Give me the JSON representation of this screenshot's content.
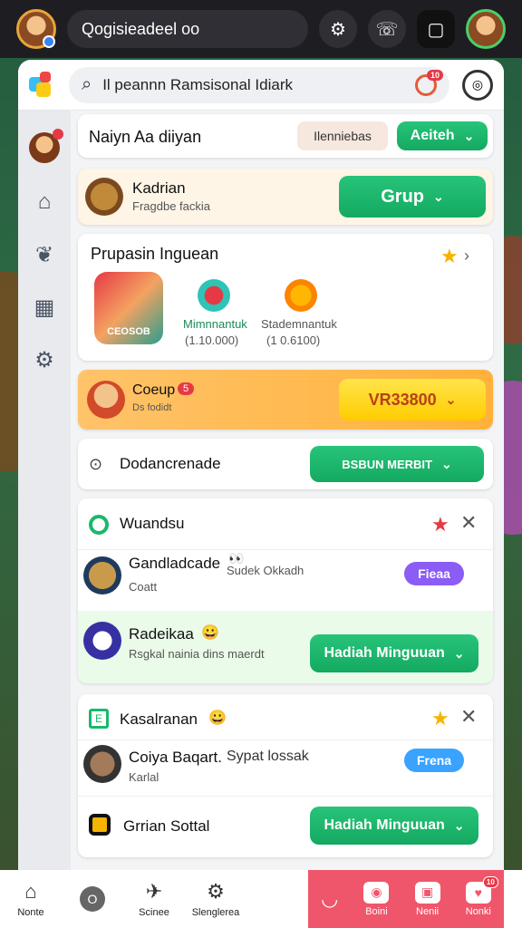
{
  "topbar": {
    "search_text": "Qogisieadeel oo"
  },
  "header": {
    "search_text": "Il peannn Ramsisonal Idiark",
    "notif_count": "10"
  },
  "cards": {
    "row1": {
      "title": "Naiyn Aa diiyan",
      "tag": "Ilenniebas",
      "button": "Aeiteh"
    },
    "row2": {
      "title": "Kadrian",
      "subtitle": "Fragdbe fackia",
      "button": "Grup"
    },
    "row3": {
      "title": "Prupasin Inguean",
      "item1": {
        "name": "Mimnnantuk",
        "value": "(1.10.000)"
      },
      "item2": {
        "name": "Stademnantuk",
        "value": "(1 0.6100)"
      },
      "game_label": "CEOSOB"
    },
    "row4": {
      "title": "Coeup",
      "badge": "5",
      "subtitle": "Ds fodidt",
      "button": "VR33800"
    },
    "row5": {
      "title": "Dodancrenade",
      "button": "BSBUN MERBIT"
    },
    "group1": {
      "title": "Wuandsu",
      "item1": {
        "title": "Gandladcade",
        "emoji": "👀",
        "extra": "Sudek Okkadh",
        "subtitle": "Coatt",
        "button": "Fieaa"
      },
      "item2": {
        "title": "Radeikaa",
        "emoji": "😀",
        "subtitle": "Rsgkal nainia dins maerdt",
        "button": "Hadiah Minguuan"
      }
    },
    "group2": {
      "title": "Kasalranan",
      "emoji": "😀",
      "item1": {
        "title": "Coiya Baqart.",
        "extra": "Sypat lossak",
        "subtitle": "Karlal",
        "button": "Frena"
      },
      "item2": {
        "title": "Grrian Sottal",
        "button": "Hadiah Minguuan"
      }
    }
  },
  "bottom_nav": [
    {
      "label": "Nonte",
      "icon": "home-icon"
    },
    {
      "label": "",
      "icon": "circle-icon"
    },
    {
      "label": "Scinee",
      "icon": "bolt-icon"
    },
    {
      "label": "Slenglerea",
      "icon": "gear-icon"
    }
  ],
  "pink_nav": [
    {
      "label": "",
      "icon": "smile-icon"
    },
    {
      "label": "Boini",
      "icon": "camera-icon",
      "badge": ""
    },
    {
      "label": "Nenii",
      "icon": "image-icon"
    },
    {
      "label": "Nonki",
      "icon": "heart-icon",
      "badge": "10"
    }
  ],
  "colors": {
    "accent_green": "#19b96a",
    "accent_yellow": "#ffd21f",
    "accent_purple": "#8b5cf6",
    "accent_blue": "#3aa3ff",
    "pink": "#f0566b"
  }
}
